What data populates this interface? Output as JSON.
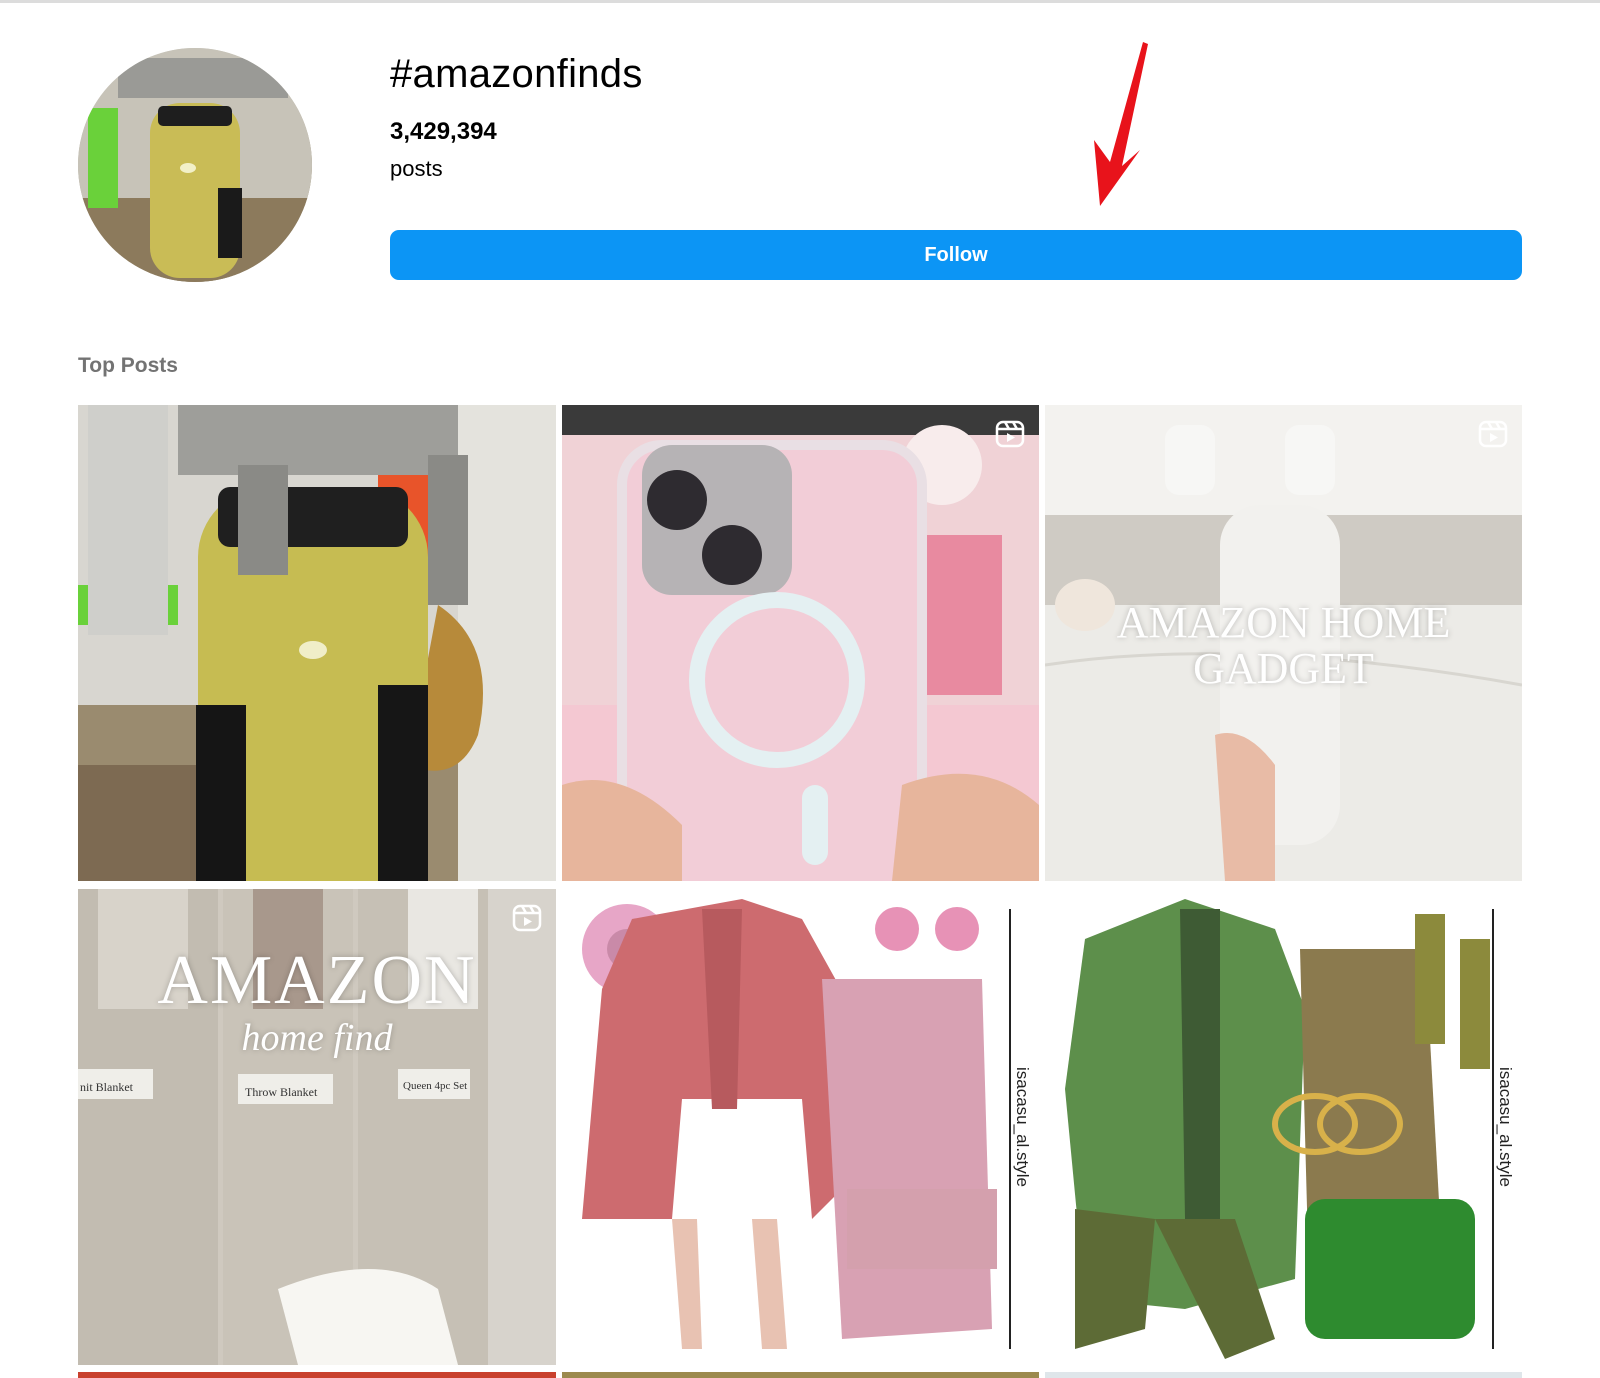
{
  "header": {
    "hashtag": "#amazonfinds",
    "post_count": "3,429,394",
    "post_label": "posts",
    "follow_label": "Follow",
    "accent_color": "#0c95f5",
    "annotation_color": "#e8131b"
  },
  "top_posts": {
    "title": "Top Posts",
    "posts": [
      {
        "subject": "mustard jar in jar-opener gadget",
        "reel": false,
        "overlay": []
      },
      {
        "subject": "pink phone with clear magnetic case",
        "reel": true,
        "overlay": []
      },
      {
        "subject": "white wall-mounted gadget held in hand",
        "reel": true,
        "overlay": [
          "AMAZON HOME",
          "GADGET"
        ]
      },
      {
        "subject": "fabric blanket storage bags",
        "reel": true,
        "overlay": [
          "AMAZON",
          "home find"
        ],
        "labels": [
          "nit Blanket",
          "Throw Blanket",
          "Queen 4pc Set"
        ]
      },
      {
        "subject": "pink outfit collage",
        "reel": false,
        "overlay": [],
        "side_text": "isacasu_al.style"
      },
      {
        "subject": "green outfit collage",
        "reel": false,
        "overlay": [],
        "side_text": "isacasu_al.style"
      }
    ]
  },
  "icons": {
    "reel": "reels-icon",
    "annotation": "red-arrow-icon"
  }
}
